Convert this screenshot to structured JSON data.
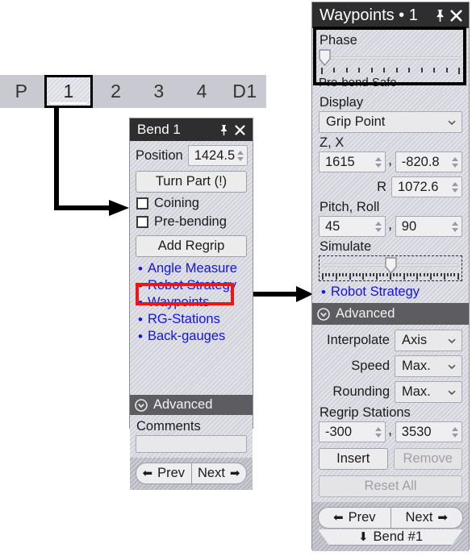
{
  "tabstrip": {
    "tabs": [
      {
        "label": "P",
        "selected": false
      },
      {
        "label": "1",
        "selected": true
      },
      {
        "label": "2",
        "selected": false
      },
      {
        "label": "3",
        "selected": false
      },
      {
        "label": "4",
        "selected": false
      },
      {
        "label": "D1",
        "selected": false
      }
    ]
  },
  "bend_panel": {
    "title": "Bend 1",
    "pin_icon": "pin-icon",
    "close_icon": "close-icon",
    "position_label": "Position",
    "position_value": "1424.5",
    "turn_part_label": "Turn Part (!)",
    "coining_label": "Coining",
    "coining_checked": false,
    "prebending_label": "Pre-bending",
    "prebending_checked": false,
    "add_regrip_label": "Add Regrip",
    "links": [
      "Angle Measure",
      "Robot Strategy",
      "Waypoints",
      "RG-Stations",
      "Back-gauges"
    ],
    "advanced_label": "Advanced",
    "comments_label": "Comments",
    "comments_value": "",
    "prev_label": "Prev",
    "next_label": "Next"
  },
  "waypoints_panel": {
    "title": "Waypoints • 1",
    "pin_icon": "pin-icon",
    "close_icon": "close-icon",
    "phase_label": "Phase",
    "phase_value": "Pre-bend Safe",
    "phase_slider_pct": 2,
    "phase_ticks": 12,
    "display_label": "Display",
    "display_value": "Grip Point",
    "zx_label": "Z, X",
    "z_value": "1615",
    "x_value": "-820.8",
    "r_label": "R",
    "r_value": "1072.6",
    "pitchroll_label": "Pitch, Roll",
    "pitch_value": "45",
    "roll_value": "90",
    "simulate_label": "Simulate",
    "simulate_slider_pct": 50,
    "simulate_ticks": 41,
    "robot_strategy_link": "Robot Strategy",
    "advanced_label": "Advanced",
    "interpolate_label": "Interpolate",
    "interpolate_value": "Axis",
    "speed_label": "Speed",
    "speed_value": "Max.",
    "rounding_label": "Rounding",
    "rounding_value": "Max.",
    "regrip_stations_label": "Regrip Stations",
    "regrip_a_value": "-300",
    "regrip_b_value": "3530",
    "insert_label": "Insert",
    "remove_label": "Remove",
    "remove_disabled": true,
    "reset_all_label": "Reset All",
    "reset_all_disabled": true,
    "prev_label": "Prev",
    "next_label": "Next",
    "bend_label": "Bend #1",
    "comma": ","
  },
  "annotations": {
    "highlight_phase_color": "#000000",
    "highlight_waypoints_color": "#ef1515",
    "arrow_color": "#000000"
  }
}
